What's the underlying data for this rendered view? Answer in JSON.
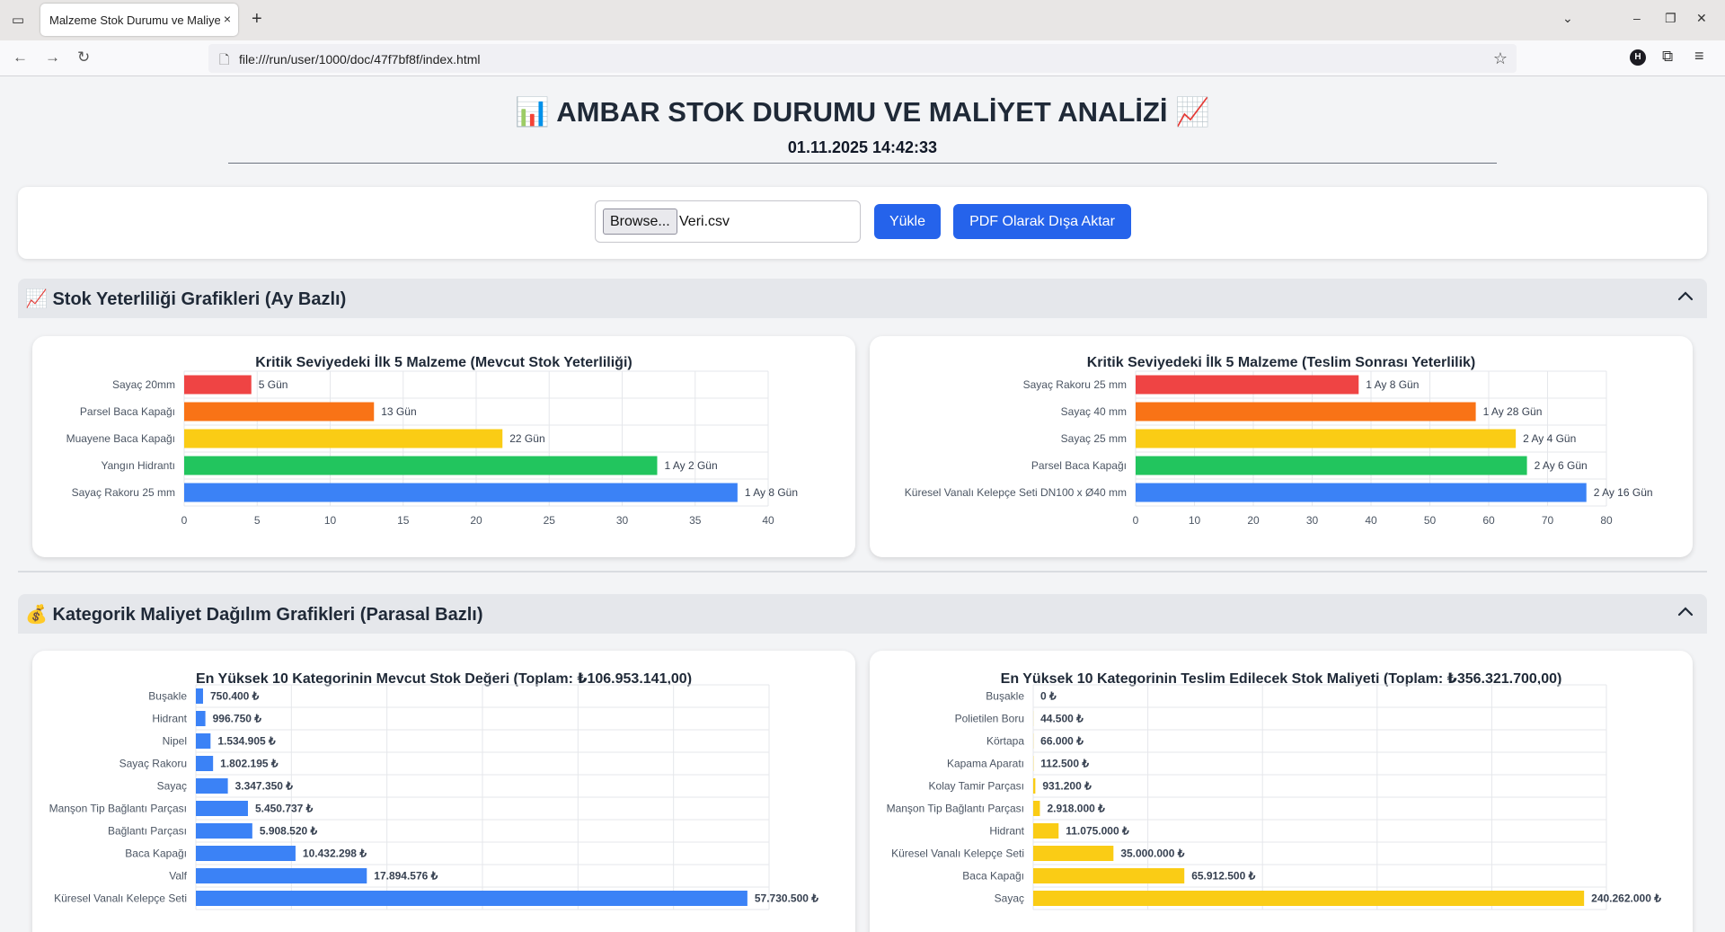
{
  "browser": {
    "tab_title": "Malzeme Stok Durumu ve Maliyet Analizi",
    "tab_close": "×",
    "new_tab": "+",
    "url": "file:///run/user/1000/doc/47f7bf8f/index.html",
    "profile_initial": "H"
  },
  "page": {
    "title": "📊 AMBAR STOK DURUMU VE MALİYET ANALİZİ 📈",
    "datetime": "01.11.2025 14:42:33"
  },
  "upload": {
    "browse_label": "Browse...",
    "file_name": "Veri.csv",
    "load_label": "Yükle",
    "pdf_label": "PDF Olarak Dışa Aktar"
  },
  "sections": {
    "stock": {
      "title": "📈 Stok Yeterliliği Grafikleri (Ay Bazlı)"
    },
    "cost": {
      "title": "💰 Kategorik Maliyet Dağılım Grafikleri (Parasal Bazlı)"
    }
  },
  "colors": {
    "red": "#ef4444",
    "orange": "#f97316",
    "yellow": "#facc15",
    "green": "#22c55e",
    "blue": "#3b82f6",
    "gold": "#facc15",
    "accent": "#2563eb"
  },
  "chart_data": [
    {
      "type": "bar",
      "orientation": "horizontal",
      "title": "Kritik Seviyedeki İlk 5 Malzeme (Mevcut Stok Yeterliliği)",
      "categories": [
        "Sayaç 20mm",
        "Parsel Baca Kapağı",
        "Muayene Baca Kapağı",
        "Yangın Hidrantı",
        "Sayaç Rakoru 25 mm"
      ],
      "values": [
        4.6,
        13,
        21.8,
        32.4,
        37.9
      ],
      "data_labels": [
        "5 Gün",
        "13 Gün",
        "22 Gün",
        "1 Ay 2 Gün",
        "1 Ay 8 Gün"
      ],
      "bar_colors": [
        "#ef4444",
        "#f97316",
        "#facc15",
        "#22c55e",
        "#3b82f6"
      ],
      "xlim": [
        0,
        40
      ],
      "xticks": [
        0,
        5,
        10,
        15,
        20,
        25,
        30,
        35,
        40
      ],
      "grid": true
    },
    {
      "type": "bar",
      "orientation": "horizontal",
      "title": "Kritik Seviyedeki İlk 5 Malzeme (Teslim Sonrası Yeterlilik)",
      "categories": [
        "Sayaç Rakoru 25 mm",
        "Sayaç 40 mm",
        "Sayaç 25 mm",
        "Parsel Baca Kapağı",
        "Küresel Vanalı Kelepçe Seti DN100 x Ø40 mm"
      ],
      "values": [
        37.9,
        57.8,
        64.6,
        66.5,
        76.6
      ],
      "data_labels": [
        "1 Ay 8 Gün",
        "1 Ay 28 Gün",
        "2 Ay 4 Gün",
        "2 Ay 6 Gün",
        "2 Ay 16 Gün"
      ],
      "bar_colors": [
        "#ef4444",
        "#f97316",
        "#facc15",
        "#22c55e",
        "#3b82f6"
      ],
      "xlim": [
        0,
        80
      ],
      "xticks": [
        0,
        10,
        20,
        30,
        40,
        50,
        60,
        70,
        80
      ],
      "grid": true
    },
    {
      "type": "bar",
      "orientation": "horizontal",
      "title": "En Yüksek 10 Kategorinin Mevcut Stok Değeri (Toplam: ₺106.953.141,00)",
      "categories": [
        "Buşakle",
        "Hidrant",
        "Nipel",
        "Sayaç Rakoru",
        "Sayaç",
        "Manşon Tip Bağlantı Parçası",
        "Bağlantı Parçası",
        "Baca Kapağı",
        "Valf",
        "Küresel Vanalı Kelepçe Seti"
      ],
      "values": [
        750400,
        996750,
        1534905,
        1802195,
        3347350,
        5450737,
        5908520,
        10432298,
        17894576,
        57730500
      ],
      "data_labels": [
        "750.400 ₺",
        "996.750 ₺",
        "1.534.905 ₺",
        "1.802.195 ₺",
        "3.347.350 ₺",
        "5.450.737 ₺",
        "5.908.520 ₺",
        "10.432.298 ₺",
        "17.894.576 ₺",
        "57.730.500 ₺"
      ],
      "bar_colors": [
        "#3b82f6"
      ],
      "xlim": [
        0,
        60000000
      ],
      "grid": true
    },
    {
      "type": "bar",
      "orientation": "horizontal",
      "title": "En Yüksek 10 Kategorinin Teslim Edilecek Stok Maliyeti (Toplam: ₺356.321.700,00)",
      "categories": [
        "Buşakle",
        "Polietilen Boru",
        "Körtapa",
        "Kapama Aparatı",
        "Kolay Tamir Parçası",
        "Manşon Tip Bağlantı Parçası",
        "Hidrant",
        "Küresel Vanalı Kelepçe Seti",
        "Baca Kapağı",
        "Sayaç"
      ],
      "values": [
        0,
        44500,
        66000,
        112500,
        931200,
        2918000,
        11075000,
        35000000,
        65912500,
        240262000
      ],
      "data_labels": [
        "0 ₺",
        "44.500 ₺",
        "66.000 ₺",
        "112.500 ₺",
        "931.200 ₺",
        "2.918.000 ₺",
        "11.075.000 ₺",
        "35.000.000 ₺",
        "65.912.500 ₺",
        "240.262.000 ₺"
      ],
      "bar_colors": [
        "#facc15"
      ],
      "xlim": [
        0,
        250000000
      ],
      "grid": true
    }
  ]
}
